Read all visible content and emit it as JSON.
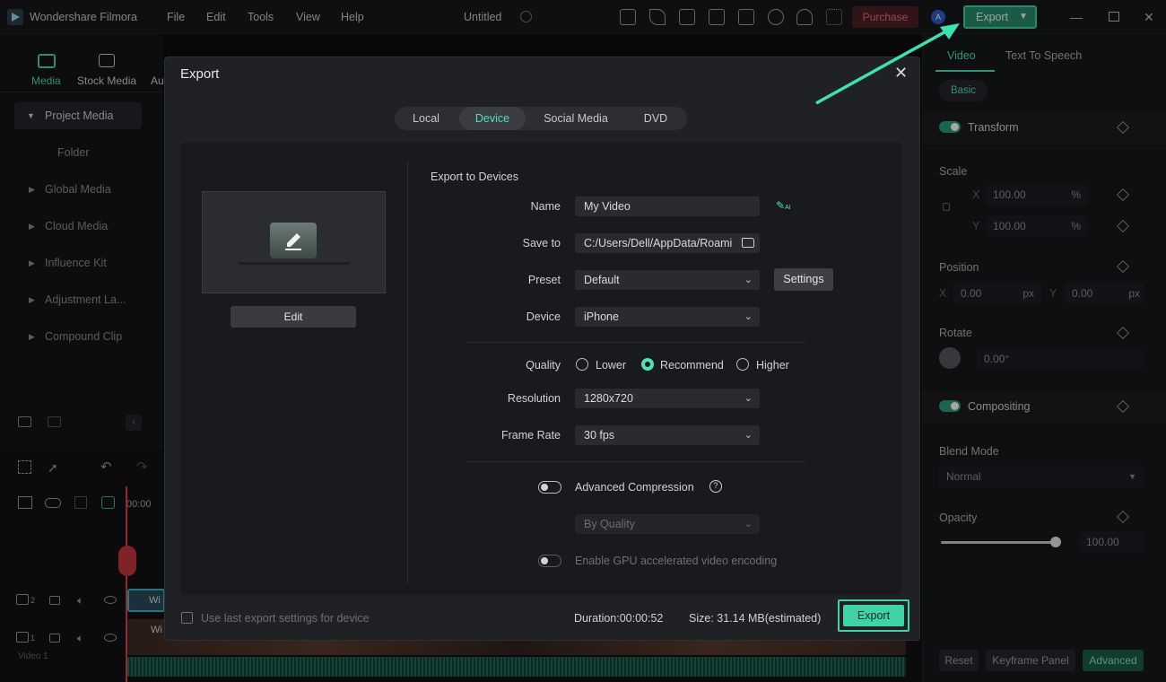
{
  "app": {
    "name": "Wondershare Filmora",
    "title": "Untitled",
    "purchase": "Purchase",
    "export": "Export",
    "avatar": "A"
  },
  "menu": [
    "File",
    "Edit",
    "Tools",
    "View",
    "Help"
  ],
  "left": {
    "tabs": [
      "Media",
      "Stock Media",
      "Au"
    ],
    "items": [
      "Project Media",
      "Folder",
      "Global Media",
      "Cloud Media",
      "Influence Kit",
      "Adjustment La...",
      "Compound Clip"
    ]
  },
  "timeline": {
    "time": "00:00",
    "track2": "2",
    "track1": "1",
    "clip_label": "Wi",
    "video_label": "Video 1"
  },
  "right": {
    "tabs": [
      "Video",
      "Text To Speech"
    ],
    "basic": "Basic",
    "transform": "Transform",
    "scale": "Scale",
    "scale_x": "100.00",
    "scale_y": "100.00",
    "x": "X",
    "y": "Y",
    "pct": "%",
    "position": "Position",
    "pos_x": "0.00",
    "pos_y": "0.00",
    "px": "px",
    "rotate": "Rotate",
    "rotate_val": "0.00°",
    "compositing": "Compositing",
    "blend_mode": "Blend Mode",
    "blend_val": "Normal",
    "opacity": "Opacity",
    "opacity_val": "100.00",
    "opacity_level": 1.0,
    "reset": "Reset",
    "keyframe": "Keyframe Panel",
    "advanced": "Advanced"
  },
  "dialog": {
    "title": "Export",
    "tabs": [
      "Local",
      "Device",
      "Social Media",
      "DVD"
    ],
    "active_tab": "Device",
    "section": "Export to Devices",
    "edit": "Edit",
    "name_label": "Name",
    "name_val": "My Video",
    "save_label": "Save to",
    "save_val": "C:/Users/Dell/AppData/Roami",
    "preset_label": "Preset",
    "preset_val": "Default",
    "settings": "Settings",
    "device_label": "Device",
    "device_val": "iPhone",
    "quality_label": "Quality",
    "q_lower": "Lower",
    "q_recommend": "Recommend",
    "q_higher": "Higher",
    "resolution_label": "Resolution",
    "resolution_val": "1280x720",
    "framerate_label": "Frame Rate",
    "framerate_val": "30 fps",
    "adv_comp": "Advanced Compression",
    "by_quality": "By Quality",
    "gpu": "Enable GPU accelerated video encoding",
    "use_last": "Use last export settings for device",
    "duration": "Duration:00:00:52",
    "size": "Size: 31.14 MB(estimated)",
    "export": "Export"
  },
  "colors": {
    "accent": "#3fd3a7",
    "purchase": "#e6737d"
  }
}
